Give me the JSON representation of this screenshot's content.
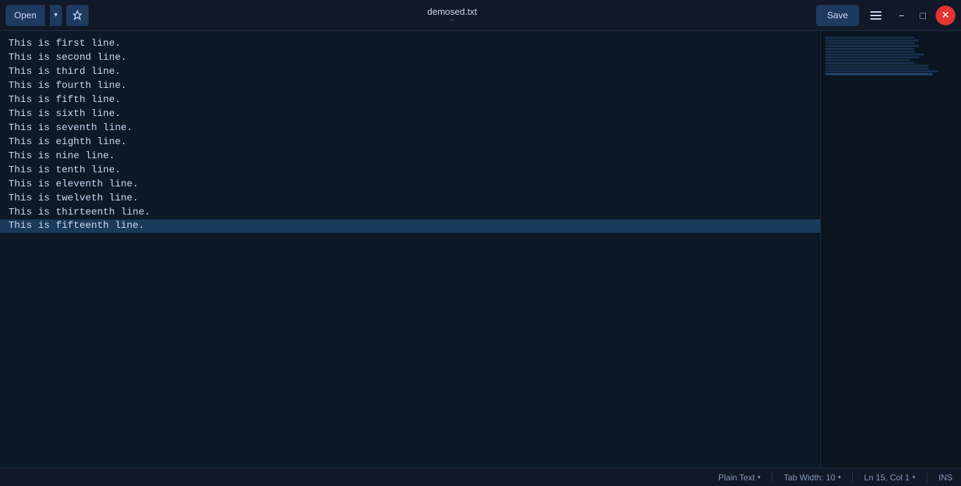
{
  "titlebar": {
    "open_label": "Open",
    "dropdown_arrow": "▾",
    "pin_icon": "📌",
    "filename": "demosed.txt",
    "subtitle": "~",
    "save_label": "Save",
    "minimize_label": "−",
    "maximize_label": "□",
    "close_label": "✕"
  },
  "editor": {
    "lines": [
      "This is first line.",
      "This is second line.",
      "This is third line.",
      "This is fourth line.",
      "This is fifth line.",
      "This is sixth line.",
      "This is seventh line.",
      "This is eighth line.",
      "This is nine line.",
      "This is tenth line.",
      "This is eleventh line.",
      "This is twelveth line.",
      "This is thirteenth line.",
      "This is fifteenth line."
    ],
    "highlighted_line_index": 13
  },
  "statusbar": {
    "language_label": "Plain Text",
    "tab_width_label": "Tab Width: 10",
    "cursor_position": "Ln 15, Col 1",
    "insert_mode": "INS"
  }
}
